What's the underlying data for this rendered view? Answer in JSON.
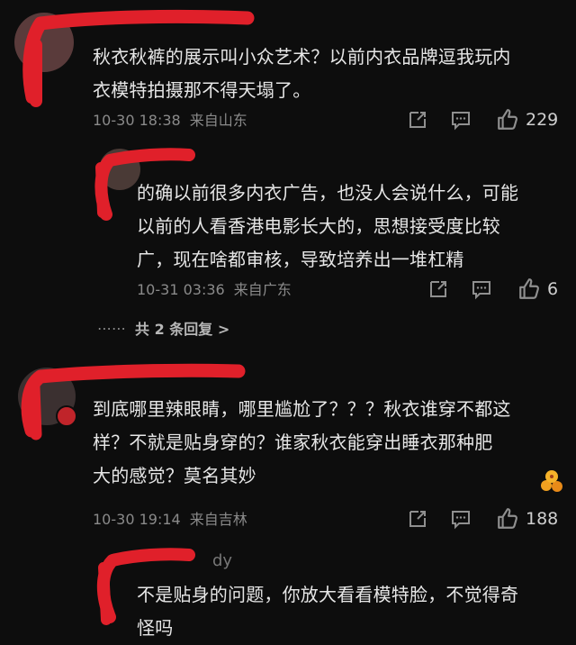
{
  "comments": [
    {
      "text_lines": [
        "秋衣秋裤的展示叫小众艺术？以前内衣品牌逗我玩内",
        "衣模特拍摄那不得天塌了。"
      ],
      "date": "10-30 18:38",
      "location": "来自山东",
      "likes": "229"
    },
    {
      "text_lines": [
        "的确以前很多内衣广告，也没人会说什么，可能",
        "以前的人看香港电影长大的，思想接受度比较",
        "广，现在啥都审核，导致培养出一堆杠精"
      ],
      "date": "10-31 03:36",
      "location": "来自广东",
      "likes": "6"
    },
    {
      "text_lines": [
        "到底哪里辣眼睛，哪里尴尬了？？？秋衣谁穿不都这",
        "样？不就是贴身穿的？谁家秋衣能穿出睡衣那种肥",
        "大的感觉？莫名其妙"
      ],
      "date": "10-30 19:14",
      "location": "来自吉林",
      "likes": "188"
    },
    {
      "username_partial": "dy",
      "text_lines": [
        "不是贴身的问题，你放大看看模特脸，不觉得奇",
        "怪吗"
      ]
    }
  ],
  "replies_more": {
    "dots": "⋯⋯",
    "label": "共 2 条回复 >"
  },
  "colors": {
    "background": "#0d0d0d",
    "redaction": "#e0202a"
  }
}
